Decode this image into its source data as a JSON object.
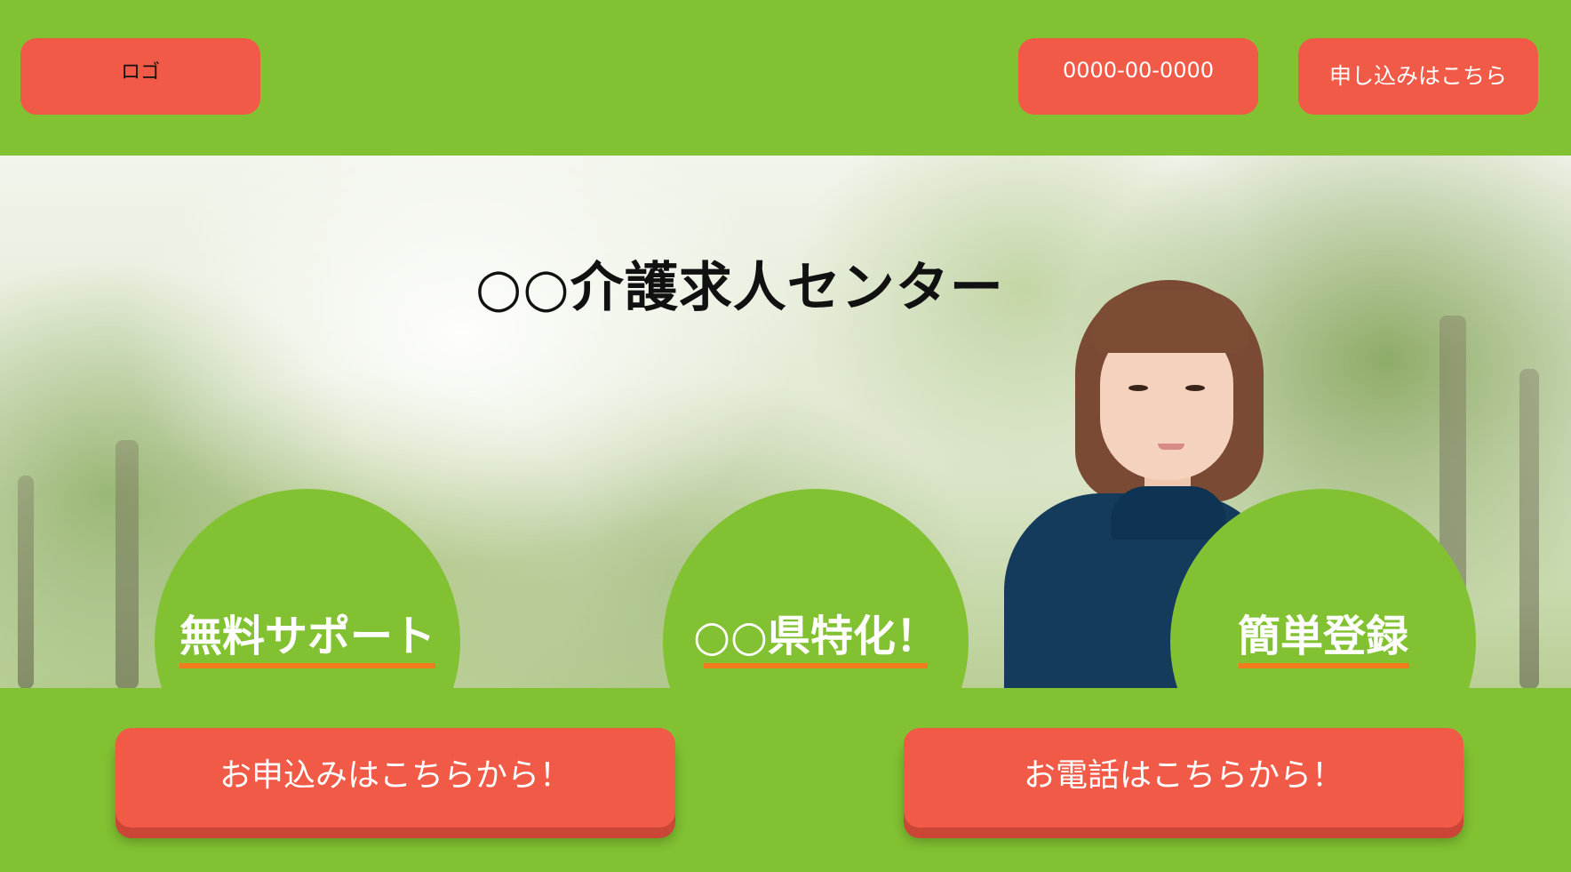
{
  "header": {
    "logo_label": "ロゴ",
    "phone_label": "0000-00-0000",
    "apply_label": "申し込みはこちら"
  },
  "hero": {
    "title": "○○介護求人センター"
  },
  "features": [
    {
      "label": "無料サポート"
    },
    {
      "label": "○○県特化！"
    },
    {
      "label": "簡単登録"
    }
  ],
  "cta": {
    "apply_label": "お申込みはこちらから！",
    "phone_label": "お電話はこちらから！"
  },
  "colors": {
    "brand_green": "#82c232",
    "button_red": "#f15a46",
    "underline_orange": "#f27b1d"
  }
}
